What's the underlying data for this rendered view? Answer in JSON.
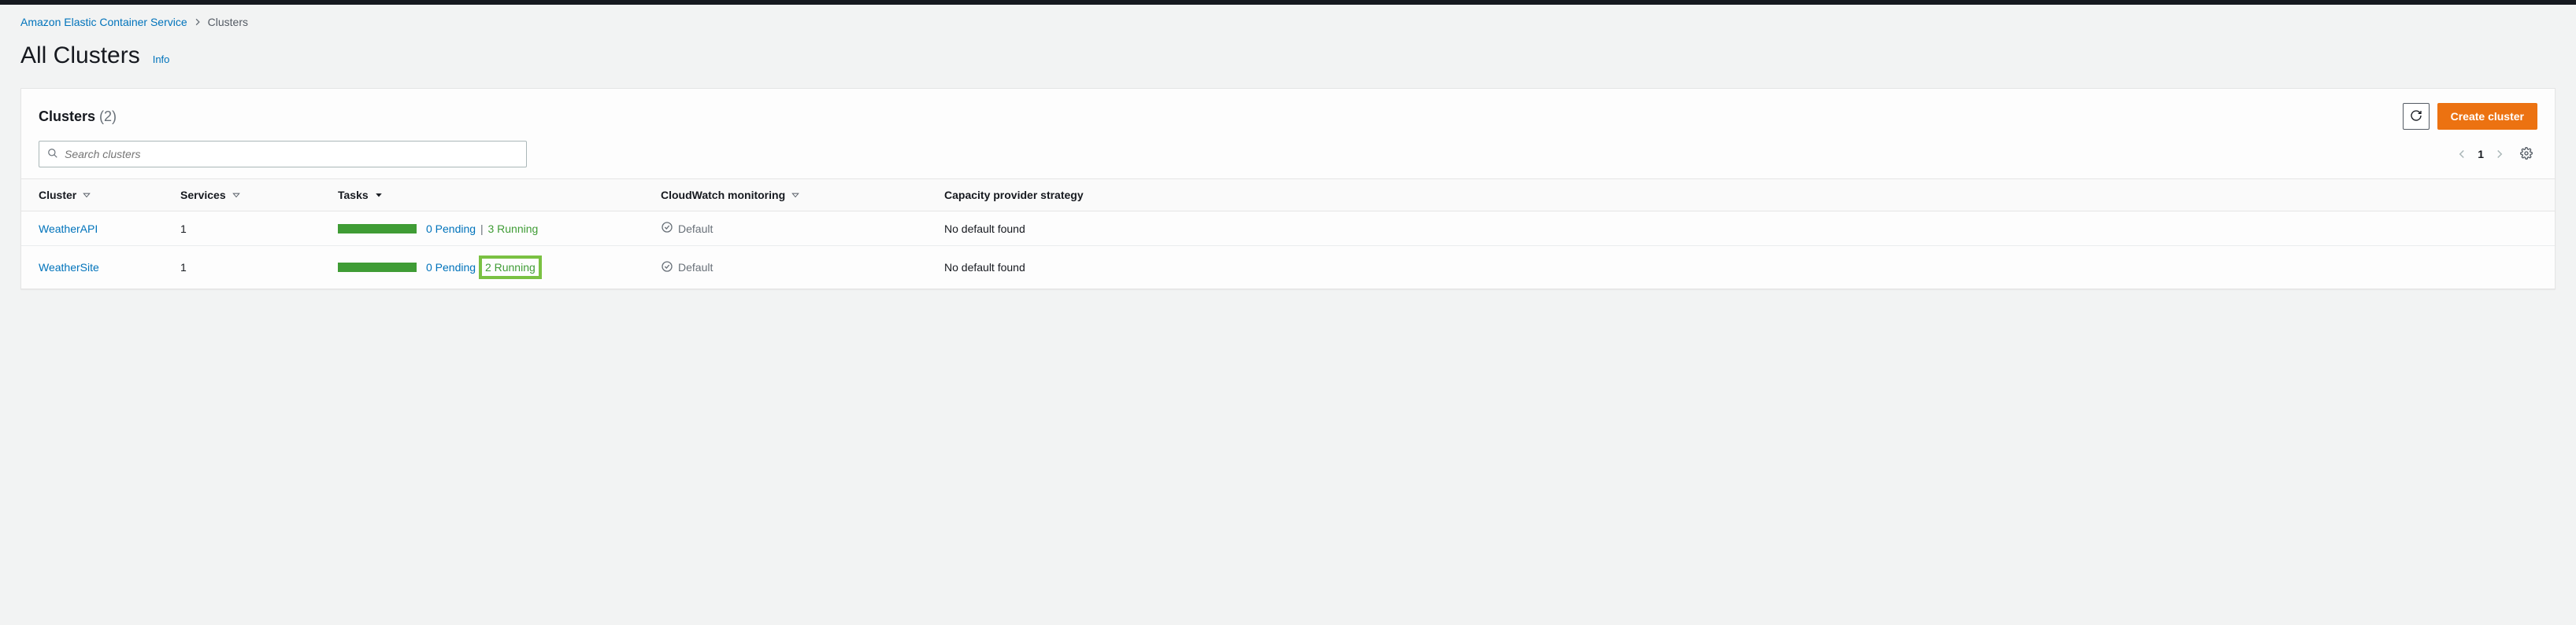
{
  "breadcrumb": {
    "root": "Amazon Elastic Container Service",
    "current": "Clusters"
  },
  "page": {
    "title": "All Clusters",
    "info_label": "Info"
  },
  "panel": {
    "title": "Clusters",
    "count_display": "(2)",
    "refresh_label": "Refresh",
    "create_label": "Create cluster"
  },
  "search": {
    "placeholder": "Search clusters"
  },
  "pager": {
    "page": "1"
  },
  "columns": {
    "cluster": "Cluster",
    "services": "Services",
    "tasks": "Tasks",
    "cloudwatch": "CloudWatch monitoring",
    "capacity": "Capacity provider strategy"
  },
  "rows": [
    {
      "name": "WeatherAPI",
      "services": "1",
      "tasks_pending": "0 Pending",
      "tasks_running": "3 Running",
      "running_highlight": false,
      "cloudwatch": "Default",
      "capacity": "No default found"
    },
    {
      "name": "WeatherSite",
      "services": "1",
      "tasks_pending": "0 Pending",
      "tasks_running": "2 Running",
      "running_highlight": true,
      "cloudwatch": "Default",
      "capacity": "No default found"
    }
  ]
}
